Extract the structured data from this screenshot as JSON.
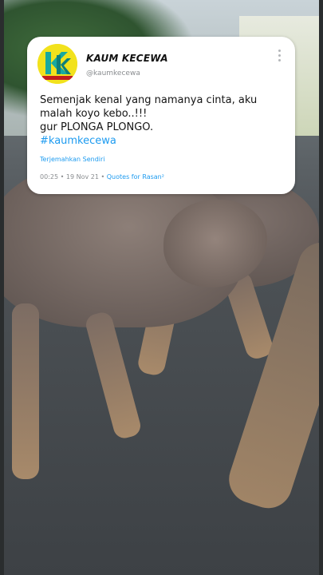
{
  "tweet": {
    "avatar_logo_text": "KAUM KECEWA",
    "display_name": "KAUM KECEWA",
    "handle": "@kaumkecewa",
    "text_lines": [
      "Semenjak kenal yang namanya cinta, aku",
      "malah koyo kebo..!!!",
      "gur PLONGA PLONGO."
    ],
    "hashtag": "#kaumkecewa",
    "translate_label": "Terjemahkan Sendiri",
    "time": "00:25",
    "date": "19 Nov 21",
    "separator": "•",
    "source": "Quotes for Rasan²"
  },
  "icons": {
    "more": "more-vertical-icon",
    "avatar": "kaum-kecewa-logo"
  },
  "colors": {
    "card_background": "#ffffff",
    "link_blue": "#1d9bf0",
    "muted_gray": "#8a8d90",
    "avatar_yellow": "#f2e21d"
  }
}
